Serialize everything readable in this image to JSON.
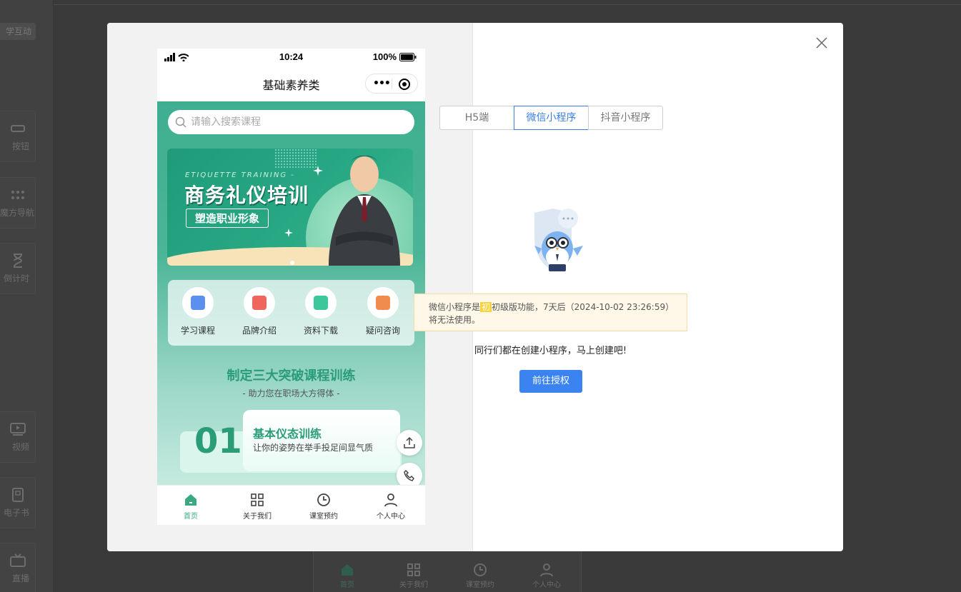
{
  "background": {
    "tag_label": "学互动",
    "cards": [
      {
        "label": "按钮",
        "icon": "button-icon"
      },
      {
        "label": "魔方导航",
        "icon": "grid-dots-icon"
      },
      {
        "label": "倒计时",
        "icon": "hourglass-icon"
      },
      {
        "label": "视频",
        "icon": "video-icon"
      },
      {
        "label": "电子书",
        "icon": "ebook-icon"
      },
      {
        "label": "直播",
        "icon": "tv-icon"
      }
    ],
    "bottom_tabs": [
      "首页",
      "关于我们",
      "课室预约",
      "个人中心"
    ]
  },
  "phone": {
    "status": {
      "time": "10:24",
      "battery": "100%"
    },
    "nav_title": "基础素养类",
    "search_placeholder": "请输入搜索课程",
    "banner": {
      "en": "ETIQUETTE TRAINING -",
      "title": "商务礼仪培训",
      "subtitle": "塑造职业形象"
    },
    "quick_nav": [
      {
        "label": "学习课程",
        "color": "#5b8ff0"
      },
      {
        "label": "品牌介绍",
        "color": "#f0665c"
      },
      {
        "label": "资料下载",
        "color": "#3ec79a"
      },
      {
        "label": "疑问咨询",
        "color": "#f08d4e"
      }
    ],
    "section_title": "制定三大突破课程训练",
    "section_subtitle": "- 助力您在职场大方得体 -",
    "card": {
      "num": "01",
      "title": "基本仪态训练",
      "desc": "让你的姿势在举手投足间显气质"
    },
    "tabbar": [
      {
        "label": "首页",
        "active": true
      },
      {
        "label": "关于我们",
        "active": false
      },
      {
        "label": "课室预约",
        "active": false
      },
      {
        "label": "个人中心",
        "active": false
      }
    ]
  },
  "right": {
    "segments": [
      {
        "label": "H5端",
        "active": false
      },
      {
        "label": "微信小程序",
        "active": true
      },
      {
        "label": "抖音小程序",
        "active": false
      }
    ],
    "notice_prefix": "微信小程序是",
    "notice_badge": "初",
    "notice_suffix": "初级版功能，7天后（2024-10-02 23:26:59）将无法使用。",
    "hint": "同行们都在创建小程序，马上创建吧!",
    "button": "前往授权"
  },
  "colors": {
    "accent_blue": "#3b83f0",
    "brand_green": "#3aa982"
  }
}
